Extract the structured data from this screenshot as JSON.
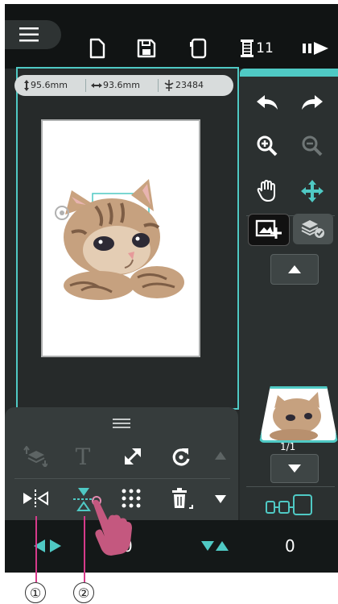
{
  "toolbar": {
    "menu_icon": "hamburger-icon",
    "buttons": [
      {
        "name": "new-file-button",
        "icon": "new-file-icon"
      },
      {
        "name": "save-button",
        "icon": "floppy-disk-icon"
      },
      {
        "name": "hoop-button",
        "icon": "hoop-frame-icon"
      },
      {
        "name": "thread-count-button",
        "icon": "thread-spool-icon",
        "label": "11"
      },
      {
        "name": "send-button",
        "icon": "send-arrow-icon"
      }
    ]
  },
  "infobar": {
    "height": "95.6mm",
    "width": "93.6mm",
    "stitches": "23484"
  },
  "right_panel": {
    "buttons": [
      {
        "name": "undo-button",
        "icon": "undo-arrow-icon"
      },
      {
        "name": "redo-button",
        "icon": "redo-arrow-icon"
      },
      {
        "name": "zoom-in-button",
        "icon": "zoom-in-icon"
      },
      {
        "name": "zoom-out-button",
        "icon": "zoom-out-icon"
      },
      {
        "name": "pan-hand-button",
        "icon": "hand-icon"
      },
      {
        "name": "move-button",
        "icon": "move-cross-icon"
      },
      {
        "name": "add-pattern-button",
        "icon": "image-add-icon"
      },
      {
        "name": "layers-button",
        "icon": "layers-check-icon"
      }
    ],
    "page_indicator": "1/1",
    "scroll_up_icon": "triangle-up-icon",
    "scroll_down_icon": "triangle-down-icon",
    "stitch_mode_icon": "hoop-connect-icon"
  },
  "bottom_panel": {
    "handle_icon": "drag-handle-icon",
    "row1": [
      {
        "name": "layer-order-button",
        "icon": "layer-order-icon",
        "enabled": false
      },
      {
        "name": "text-button",
        "icon": "text-t-icon",
        "label": "T",
        "enabled": false
      },
      {
        "name": "resize-button",
        "icon": "resize-arrow-icon",
        "enabled": true
      },
      {
        "name": "rotate-button",
        "icon": "rotate-icon",
        "enabled": true
      },
      {
        "name": "scroll-up-button",
        "icon": "triangle-up-icon",
        "enabled": false
      }
    ],
    "row2": [
      {
        "name": "mirror-horizontal-button",
        "icon": "mirror-horizontal-icon"
      },
      {
        "name": "mirror-vertical-button",
        "icon": "mirror-vertical-icon"
      },
      {
        "name": "grid-arrange-button",
        "icon": "dot-grid-icon"
      },
      {
        "name": "delete-button",
        "icon": "trash-icon"
      },
      {
        "name": "scroll-down-button",
        "icon": "triangle-down-icon"
      }
    ]
  },
  "status_bar": {
    "horizontal_value": "0",
    "vertical_value": "0"
  },
  "callouts": {
    "one": "①",
    "two": "②"
  },
  "colors": {
    "accent": "#4fc9c4",
    "background": "#262a2a",
    "topbar": "#111414",
    "pointer": "#c4587f"
  }
}
